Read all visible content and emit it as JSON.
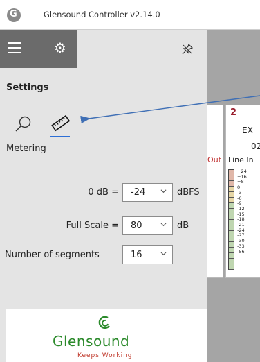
{
  "window": {
    "title": "Glensound Controller v2.14.0"
  },
  "panel": {
    "title": "Settings",
    "tab_label": "Metering",
    "rows": [
      {
        "label": "0 dB =",
        "value": "-24",
        "unit": "dBFS"
      },
      {
        "label": "Full Scale =",
        "value": "80",
        "unit": "dB"
      },
      {
        "label": "Number of segments",
        "value": "16",
        "unit": ""
      }
    ]
  },
  "channels": [
    {
      "number": "",
      "label_partial": "Out"
    },
    {
      "number": "2",
      "name_partial": "EX",
      "sub_partial": "02",
      "label": "Line In"
    }
  ],
  "meter_scale": [
    "+24",
    "+16",
    "+8",
    "0",
    "-3",
    "-6",
    "-9",
    "-12",
    "-15",
    "-18",
    "-21",
    "-24",
    "-27",
    "-30",
    "-33",
    "-56"
  ],
  "brand": {
    "name": "Glensound",
    "tagline": "Keeps Working",
    "brand_green": "#2b8a2b",
    "accent_red": "#c0392b"
  },
  "colors": {
    "accent": "#2d6fd6",
    "panel_bg": "#e4e4e4",
    "panel_header": "#6b6b6b"
  }
}
